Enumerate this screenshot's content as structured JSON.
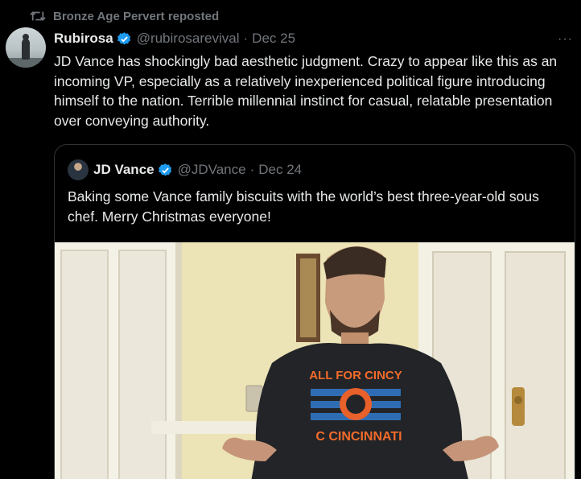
{
  "repost": {
    "text": "Bronze Age Pervert reposted"
  },
  "tweet": {
    "author_name": "Rubirosa",
    "handle": "@rubirosarevival",
    "separator": "·",
    "date": "Dec 25",
    "more": "···",
    "text": "JD Vance has shockingly bad aesthetic judgment. Crazy to appear like this as an incoming VP, especially as a relatively inexperienced political figure introducing himself to the nation. Terrible millennial instinct for casual, relatable presentation over conveying authority."
  },
  "quote": {
    "author_name": "JD Vance",
    "handle": "@JDVance",
    "separator": "·",
    "date": "Dec 24",
    "text": "Baking some Vance family biscuits with the world’s best three-year-old sous chef. Merry Christmas everyone!",
    "shirt_top": "ALL FOR CINCY",
    "shirt_bottom": "C CINCINNATI"
  },
  "colors": {
    "verified": "#1d9bf0",
    "muted": "#71767b",
    "text": "#e7e9ea",
    "background": "#000000",
    "border": "#2f3336"
  },
  "icons": {
    "repost": "repost-icon",
    "verified": "verified-badge-icon",
    "more": "more-icon"
  }
}
